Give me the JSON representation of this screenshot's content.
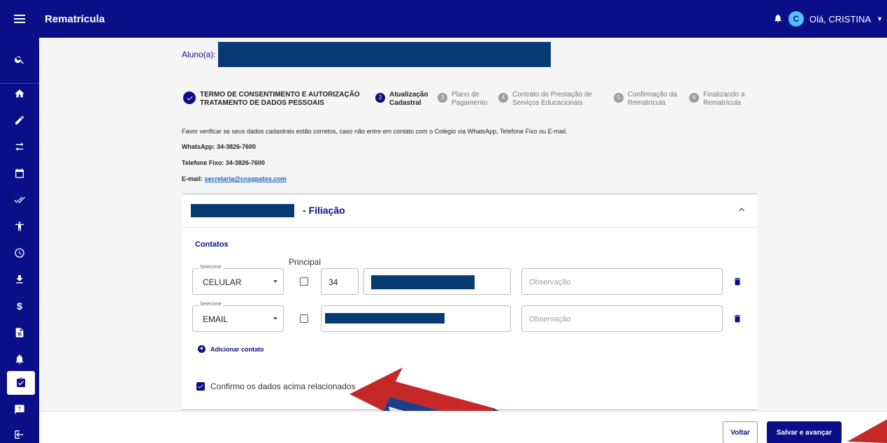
{
  "app": {
    "title": "Rematrícula",
    "greeting": "Olá, CRISTINA",
    "avatar_letter": "C"
  },
  "colors": {
    "primary": "#0b0f87",
    "redaction": "#053a72",
    "link": "#1565c0"
  },
  "sidebar": {
    "items": [
      {
        "icon": "search-icon"
      },
      {
        "icon": "home-icon"
      },
      {
        "icon": "pencil-icon"
      },
      {
        "icon": "swap-icon"
      },
      {
        "icon": "calendar-icon"
      },
      {
        "icon": "double-check-icon"
      },
      {
        "icon": "accessibility-icon"
      },
      {
        "icon": "clock-icon"
      },
      {
        "icon": "download-icon"
      },
      {
        "icon": "dollar-icon"
      },
      {
        "icon": "document-icon"
      },
      {
        "icon": "bell-icon"
      },
      {
        "icon": "clipboard-check-icon",
        "active": true
      },
      {
        "icon": "feedback-icon"
      },
      {
        "icon": "logout-icon"
      }
    ],
    "dollar": "$"
  },
  "student": {
    "label": "Aluno(a):"
  },
  "stepper": [
    {
      "num": "1",
      "line1": "TERMO DE CONSENTIMENTO E AUTORIZAÇÃO",
      "line2": "TRATAMENTO DE DADOS PESSOAIS",
      "status": "done"
    },
    {
      "num": "2",
      "line1": "Atualização",
      "line2": "Cadastral",
      "status": "current"
    },
    {
      "num": "3",
      "line1": "Plano de",
      "line2": "Pagamento",
      "status": "pending"
    },
    {
      "num": "4",
      "line1": "Contrato de Prestação de",
      "line2": "Serviços Educacionais",
      "status": "pending"
    },
    {
      "num": "5",
      "line1": "Confirmação da",
      "line2": "Rematrícula",
      "status": "pending"
    },
    {
      "num": "6",
      "line1": "Finalizando a",
      "line2": "Rematrícula",
      "status": "pending"
    }
  ],
  "info": {
    "message": "Favor verificar se seus dados cadastrais estão corretos, caso não entre em contato com o Colégio via WhatsApp, Telefone Fixo ou E-mail.",
    "whatsapp": "WhatsApp: 34-3826-7600",
    "phone": "Telefone Fixo: 34-3826-7600",
    "email_label": "E-mail:",
    "email": "secretaria@cnsgpatos.com"
  },
  "panel": {
    "title": "- Filiação",
    "contacts_title": "Contatos",
    "principal_label": "Principal",
    "contacts": [
      {
        "select_legend": "Selecione",
        "type": "CELULAR",
        "principal": false,
        "ddd": "34",
        "observation_placeholder": "Observação"
      },
      {
        "select_legend": "Selecione",
        "type": "EMAIL",
        "principal": false,
        "observation_placeholder": "Observação"
      }
    ],
    "add_contact": "Adicionar contato",
    "confirm_label": "Confirmo os dados acima relacionados",
    "confirm_checked": true
  },
  "footer": {
    "back": "Voltar",
    "save": "Salvar e avançar"
  }
}
